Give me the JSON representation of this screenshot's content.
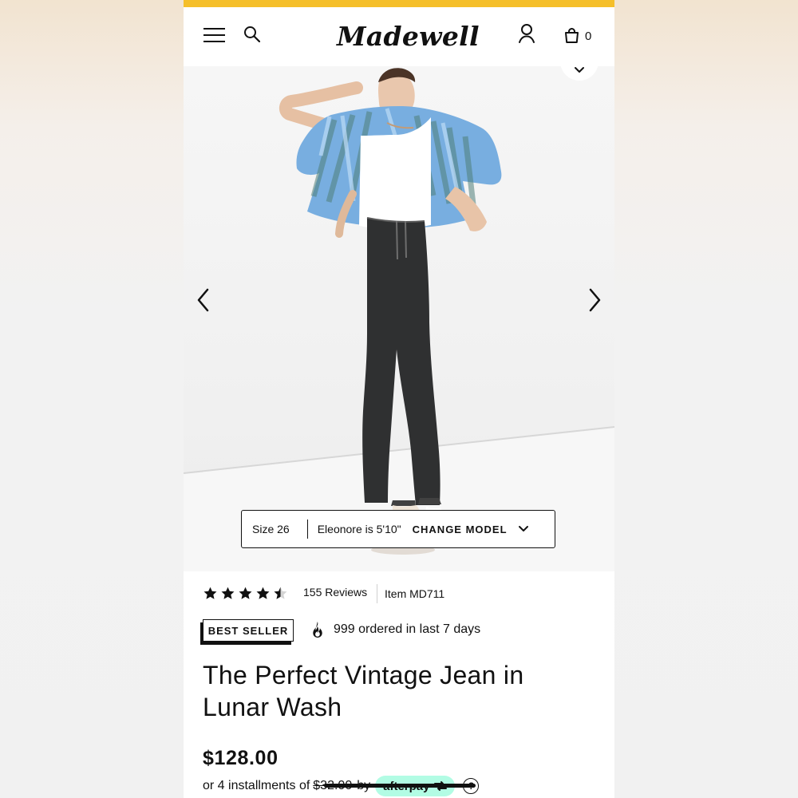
{
  "header": {
    "brand": "Madewell",
    "bag_count": "0"
  },
  "hero": {
    "size_label": "Size 26",
    "model_label": "Eleonore is 5'10\"",
    "change_model_label": "CHANGE MODEL"
  },
  "product": {
    "rating": 4.5,
    "reviews_label": "155 Reviews",
    "item_label": "Item MD711",
    "badge": "BEST SELLER",
    "ordered_label": "999 ordered in last 7 days",
    "title": "The Perfect Vintage Jean in Lunar Wash",
    "price": "$128.00",
    "installments_prefix": "or 4 installments of",
    "installments_amount": "$32.00",
    "installments_by": "by",
    "afterpay_label": "afterpay",
    "help_label": "?"
  },
  "colors": {
    "topbar": "#f5bf2a",
    "afterpay": "#b2fce4",
    "text": "#111111"
  },
  "icons": {
    "menu": "hamburger-icon",
    "search": "search-icon",
    "account": "user-icon",
    "bag": "shopping-bag-icon",
    "prev": "chevron-left-icon",
    "next": "chevron-right-icon",
    "dropdown": "chevron-down-icon",
    "fire": "fire-icon",
    "star": "star-icon"
  }
}
